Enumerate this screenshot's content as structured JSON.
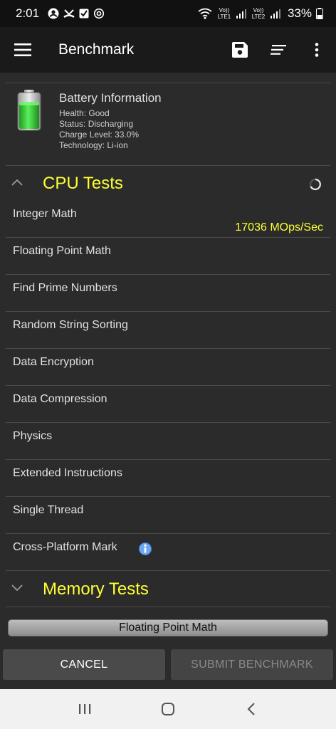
{
  "status_bar": {
    "time": "2:01",
    "sim1_label": "Vo)) LTE1",
    "sim2_label": "Vo)) LTE2",
    "battery_percent": "33%"
  },
  "app_bar": {
    "title": "Benchmark",
    "icons": [
      "menu-icon",
      "save-icon",
      "sort-icon",
      "more-vert-icon"
    ]
  },
  "battery": {
    "heading": "Battery Information",
    "health": "Health: Good",
    "status": "Status: Discharging",
    "charge": "Charge Level: 33.0%",
    "technology": "Technology: Li-ion"
  },
  "cpu_section": {
    "title": "CPU Tests",
    "tests": [
      {
        "name": "Integer Math",
        "result": "17036 MOps/Sec"
      },
      {
        "name": "Floating Point Math",
        "result": ""
      },
      {
        "name": "Find Prime Numbers",
        "result": ""
      },
      {
        "name": "Random String Sorting",
        "result": ""
      },
      {
        "name": "Data Encryption",
        "result": ""
      },
      {
        "name": "Data Compression",
        "result": ""
      },
      {
        "name": "Physics",
        "result": ""
      },
      {
        "name": "Extended Instructions",
        "result": ""
      },
      {
        "name": "Single Thread",
        "result": ""
      },
      {
        "name": "Cross-Platform Mark",
        "result": ""
      }
    ]
  },
  "memory_section": {
    "title": "Memory Tests"
  },
  "progress": {
    "label": "Floating Point Math"
  },
  "buttons": {
    "cancel": "CANCEL",
    "submit": "SUBMIT BENCHMARK"
  },
  "colors": {
    "accent_yellow": "#ffff33",
    "background": "#2b2b2b",
    "app_bar": "#1a1a1a",
    "battery_green": "#33cc33"
  }
}
